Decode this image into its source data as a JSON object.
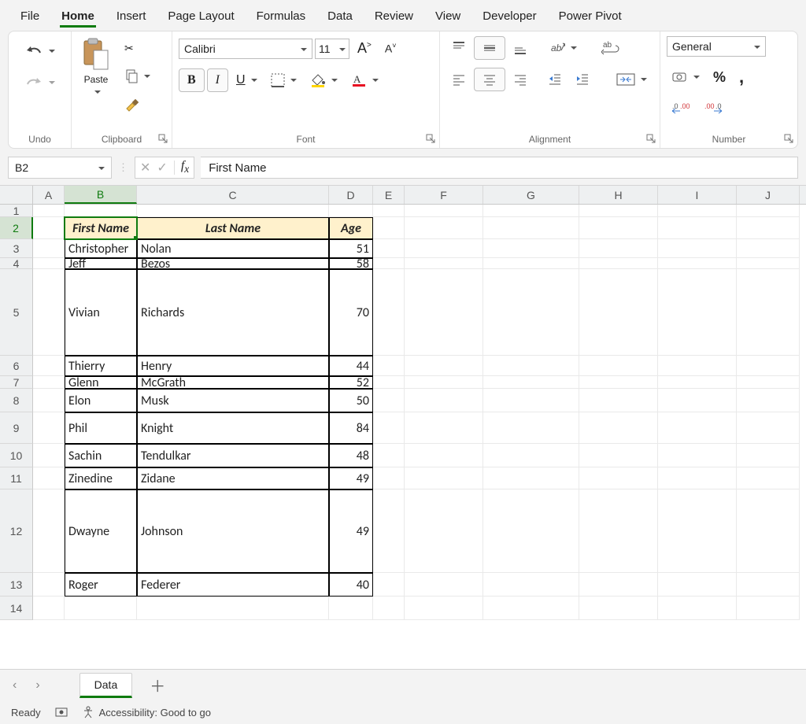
{
  "tabs": {
    "file": "File",
    "home": "Home",
    "insert": "Insert",
    "page_layout": "Page Layout",
    "formulas": "Formulas",
    "data": "Data",
    "review": "Review",
    "view": "View",
    "developer": "Developer",
    "power_pivot": "Power Pivot"
  },
  "ribbon": {
    "undo_label": "Undo",
    "clipboard_label": "Clipboard",
    "paste": "Paste",
    "font_label": "Font",
    "font_name": "Calibri",
    "font_size": "11",
    "bold": "B",
    "italic": "I",
    "underline": "U",
    "alignment_label": "Alignment",
    "number_label": "Number",
    "number_format": "General"
  },
  "name_box": "B2",
  "formula": "First Name",
  "columns": [
    "A",
    "B",
    "C",
    "D",
    "E",
    "F",
    "G",
    "H",
    "I",
    "J"
  ],
  "row_heights": {
    "r1": 16,
    "r2": 28,
    "r3": 24,
    "r4": 14,
    "r5": 110,
    "r6": 26,
    "r7": 16,
    "r8": 30,
    "r9": 40,
    "r10": 30,
    "r11": 28,
    "r12": 106,
    "r13": 30,
    "r14": 30
  },
  "header": {
    "b": "First Name",
    "c": "Last Name",
    "d": "Age"
  },
  "rows": [
    {
      "first": "Christopher",
      "last": "Nolan",
      "age": "51"
    },
    {
      "first": "Jeff",
      "last": "Bezos",
      "age": "58"
    },
    {
      "first": "Vivian",
      "last": "Richards",
      "age": "70"
    },
    {
      "first": "Thierry",
      "last": "Henry",
      "age": "44"
    },
    {
      "first": "Glenn",
      "last": "McGrath",
      "age": "52"
    },
    {
      "first": "Elon",
      "last": "Musk",
      "age": "50"
    },
    {
      "first": "Phil",
      "last": "Knight",
      "age": "84"
    },
    {
      "first": "Sachin",
      "last": "Tendulkar",
      "age": "48"
    },
    {
      "first": "Zinedine",
      "last": "Zidane",
      "age": "49"
    },
    {
      "first": "Dwayne",
      "last": "Johnson",
      "age": "49"
    },
    {
      "first": "Roger",
      "last": "Federer",
      "age": "40"
    }
  ],
  "sheet": "Data",
  "status": {
    "ready": "Ready",
    "accessibility": "Accessibility: Good to go"
  },
  "glyphs": {
    "chev_left": "‹",
    "chev_right": "›",
    "plus": "＋",
    "increase_font": "A",
    "decrease_font": "A"
  }
}
